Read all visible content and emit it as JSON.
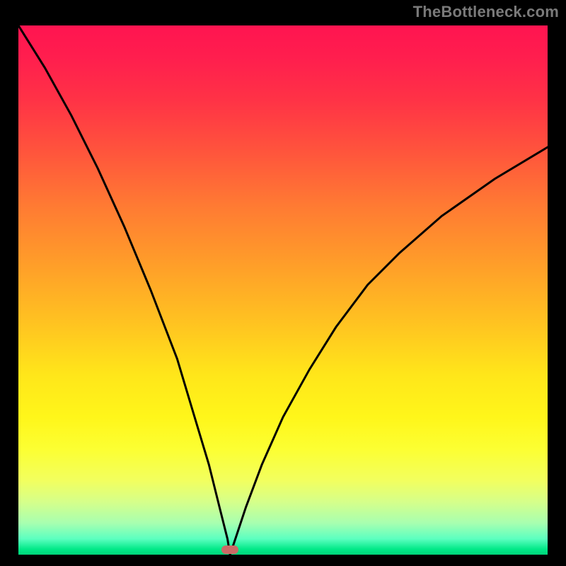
{
  "watermark": {
    "text": "TheBottleneck.com"
  },
  "chart_data": {
    "type": "line",
    "title": "",
    "xlabel": "",
    "ylabel": "",
    "xlim": [
      0,
      100
    ],
    "ylim": [
      0,
      100
    ],
    "optimum_x": 40,
    "marker": {
      "x_pct": 40,
      "y_pct": 99,
      "color": "#cb6a66"
    },
    "gradient_stops": [
      {
        "pct": 0,
        "color": "#ff1450"
      },
      {
        "pct": 14,
        "color": "#ff3246"
      },
      {
        "pct": 34,
        "color": "#ff7a33"
      },
      {
        "pct": 56,
        "color": "#ffc221"
      },
      {
        "pct": 74,
        "color": "#fff61a"
      },
      {
        "pct": 90,
        "color": "#d6ff8a"
      },
      {
        "pct": 100,
        "color": "#00d47a"
      }
    ],
    "series": [
      {
        "name": "left-branch",
        "approach": "from-left",
        "x": [
          0,
          5,
          10,
          15,
          20,
          25,
          30,
          33,
          36,
          38,
          39.5,
          40
        ],
        "y": [
          100,
          92,
          83,
          73,
          62,
          50,
          37,
          27,
          17,
          9,
          3,
          0
        ]
      },
      {
        "name": "right-branch",
        "approach": "from-right",
        "x": [
          40,
          41,
          43,
          46,
          50,
          55,
          60,
          66,
          72,
          80,
          90,
          100
        ],
        "y": [
          0,
          3,
          9,
          17,
          26,
          35,
          43,
          51,
          57,
          64,
          71,
          77
        ]
      }
    ]
  }
}
